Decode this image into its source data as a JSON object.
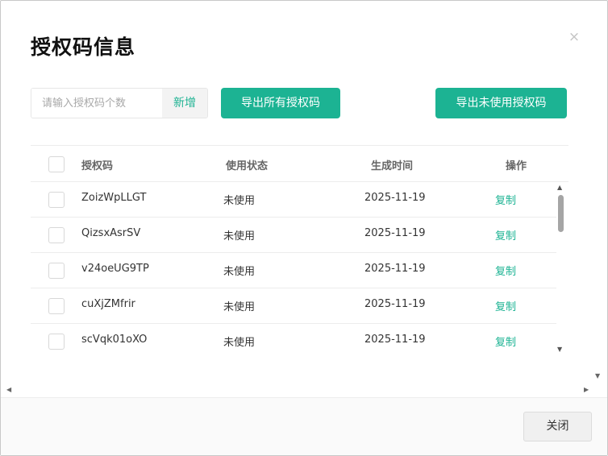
{
  "dialog": {
    "title": "授权码信息",
    "close_glyph": "×"
  },
  "toolbar": {
    "count_placeholder": "请输入授权码个数",
    "add_label": "新增",
    "export_all_label": "导出所有授权码",
    "export_unused_label": "导出未使用授权码"
  },
  "table": {
    "headers": {
      "code": "授权码",
      "status": "使用状态",
      "created": "生成时间",
      "action": "操作"
    },
    "rows": [
      {
        "code": "ZoizWpLLGT",
        "status": "未使用",
        "created": "2025-11-19",
        "action": "复制"
      },
      {
        "code": "QizsxAsrSV",
        "status": "未使用",
        "created": "2025-11-19",
        "action": "复制"
      },
      {
        "code": "v24oeUG9TP",
        "status": "未使用",
        "created": "2025-11-19",
        "action": "复制"
      },
      {
        "code": "cuXjZMfrir",
        "status": "未使用",
        "created": "2025-11-19",
        "action": "复制"
      },
      {
        "code": "scVqk01oXO",
        "status": "未使用",
        "created": "2025-11-19",
        "action": "复制"
      }
    ]
  },
  "footer": {
    "close_label": "关闭"
  },
  "icons": {
    "scroll_up": "▲",
    "scroll_down": "▼",
    "scroll_left": "◀",
    "scroll_right": "▶"
  },
  "colors": {
    "accent": "#1cb393"
  }
}
